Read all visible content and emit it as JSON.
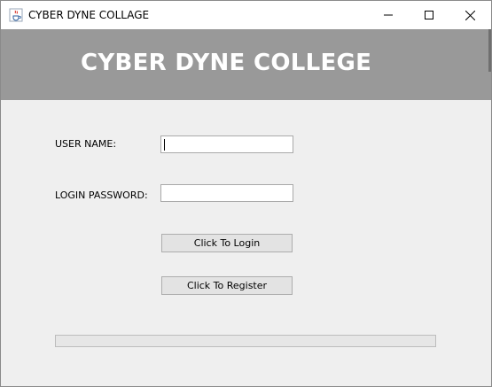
{
  "window": {
    "title": "CYBER DYNE COLLAGE",
    "icon": "java-cup-icon"
  },
  "banner": {
    "title": "CYBER DYNE COLLEGE",
    "background": "#999999",
    "text_color": "#ffffff"
  },
  "form": {
    "username_label": "USER NAME:",
    "username_value": "",
    "password_label": "LOGIN PASSWORD:",
    "password_value": "",
    "login_button": "Click To Login",
    "register_button": "Click To Register"
  },
  "progress": {
    "value": 0
  }
}
